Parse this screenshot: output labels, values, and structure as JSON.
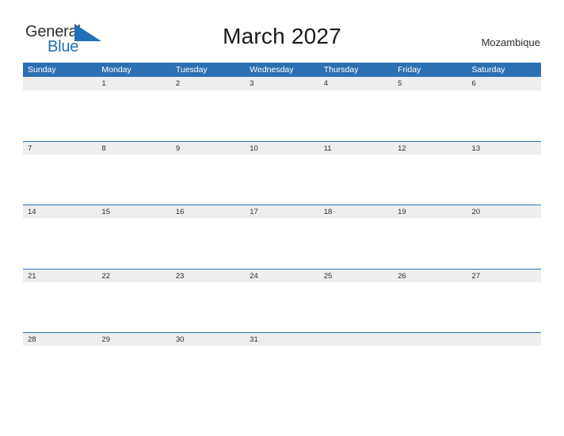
{
  "brand": {
    "name_line1": "General",
    "name_line2": "Blue",
    "triangle_icon": "triangle-logo-icon",
    "color_dark": "#2d2d2d",
    "color_blue": "#1f6fb5"
  },
  "header": {
    "title": "March 2027",
    "country": "Mozambique"
  },
  "theme": {
    "header_blue": "#2b70b2",
    "band_gray": "#eeeeee",
    "separator_blue": "#2b70b2",
    "page_background": "#ffffff",
    "text_color": "#2d2d2d"
  },
  "calendar": {
    "month": "March",
    "year": "2027",
    "weekdays": [
      "Sunday",
      "Monday",
      "Tuesday",
      "Wednesday",
      "Thursday",
      "Friday",
      "Saturday"
    ],
    "weeks": [
      {
        "has_top_border": false,
        "days": [
          "",
          "1",
          "2",
          "3",
          "4",
          "5",
          "6"
        ]
      },
      {
        "has_top_border": true,
        "days": [
          "7",
          "8",
          "9",
          "10",
          "11",
          "12",
          "13"
        ]
      },
      {
        "has_top_border": true,
        "days": [
          "14",
          "15",
          "16",
          "17",
          "18",
          "19",
          "20"
        ]
      },
      {
        "has_top_border": true,
        "days": [
          "21",
          "22",
          "23",
          "24",
          "25",
          "26",
          "27"
        ]
      },
      {
        "has_top_border": true,
        "days": [
          "28",
          "29",
          "30",
          "31",
          "",
          "",
          ""
        ]
      }
    ]
  }
}
